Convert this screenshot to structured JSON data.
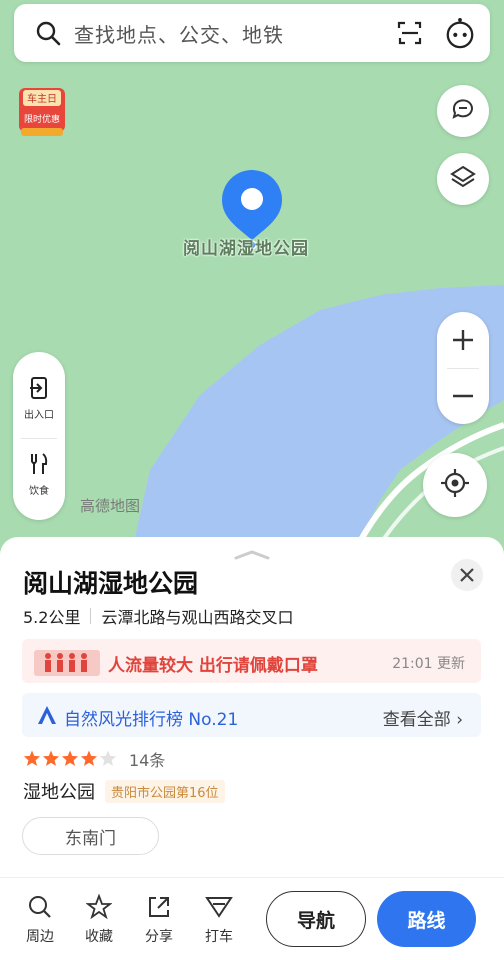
{
  "search": {
    "placeholder": "查找地点、公交、地铁"
  },
  "promo": {
    "line1": "车主日",
    "line2": "限时优惠"
  },
  "map": {
    "poi_label": "阅山湖湿地公园",
    "watermark": "高德地图",
    "left_panel": {
      "exit_label": "出入口",
      "food_label": "饮食"
    },
    "colors": {
      "land": "#a8dcb0",
      "water": "#a7c5f2",
      "road": "#ffffff",
      "pin": "#2f7ff5"
    }
  },
  "sheet": {
    "title": "阅山湖湿地公园",
    "distance": "5.2公里",
    "address": "云潭北路与观山西路交叉口",
    "crowd": {
      "text": "人流量较大 出行请佩戴口罩",
      "time": "21:01 更新"
    },
    "rank": {
      "text": "自然风光排行榜 No.21",
      "view_all": "查看全部"
    },
    "rating": {
      "stars": 4,
      "max": 5,
      "count": "14条"
    },
    "category": "湿地公园",
    "tag": "贵阳市公园第16位",
    "gate": "东南门"
  },
  "bottom": {
    "nearby": "周边",
    "favorite": "收藏",
    "share": "分享",
    "taxi": "打车",
    "navigate": "导航",
    "route": "路线"
  }
}
